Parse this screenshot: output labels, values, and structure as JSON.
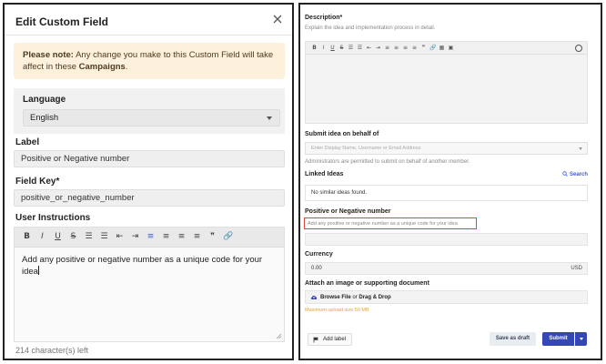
{
  "left": {
    "title": "Edit Custom Field",
    "note_prefix": "Please note:",
    "note_text": " Any change you make to this Custom Field will take affect in these ",
    "note_keyword": "Campaigns",
    "note_suffix": ".",
    "language_label": "Language",
    "language_value": "English",
    "label_label": "Label",
    "label_value": "Positive or Negative number",
    "field_key_label": "Field Key*",
    "field_key_value": "positive_or_negative_number",
    "instructions_label": "User Instructions",
    "instructions_value": "Add any positive or negative number as a unique code for your idea",
    "chars_left": "214 character(s) left",
    "toolbar": [
      "B",
      "I",
      "U",
      "S",
      "☰",
      "☰",
      "⇤",
      "⇥",
      "≡",
      "≡",
      "≡",
      "≡",
      "❞",
      "🔗"
    ]
  },
  "right": {
    "description_label": "Description",
    "description_req": "*",
    "description_help": "Explain the idea and implementation process in detail.",
    "behalf_label": "Submit idea on behalf of",
    "behalf_placeholder": "Enter Display Name, Username or Email Address",
    "behalf_help": "Administrators are permitted to submit on behalf of another member.",
    "linked_label": "Linked Ideas",
    "search_label": "Search",
    "similar_text": "No similar ideas found.",
    "posneg_label": "Positive or Negative number",
    "posneg_help": "Add any positive or negative number as a unique code for your idea",
    "currency_label": "Currency",
    "currency_value": "0.00",
    "currency_unit": "USD",
    "attach_label": "Attach an image or supporting document",
    "browse_file": "Browse File",
    "browse_or": " or ",
    "drag_drop": "Drag & Drop",
    "max_size": "Maximum upload size 50 MB",
    "add_label": "Add label",
    "save_draft": "Save as draft",
    "submit": "Submit",
    "toolbar": [
      "B",
      "I",
      "U",
      "S",
      "☰",
      "☰",
      "⇤",
      "⇥",
      "≡",
      "≡",
      "≡",
      "≡",
      "❞",
      "🔗",
      "▦",
      "▣"
    ]
  },
  "colors": {
    "accent": "#3447b5",
    "note_bg": "#fdf1dc",
    "highlight": "#e0463a",
    "warning": "#e7a12e"
  }
}
